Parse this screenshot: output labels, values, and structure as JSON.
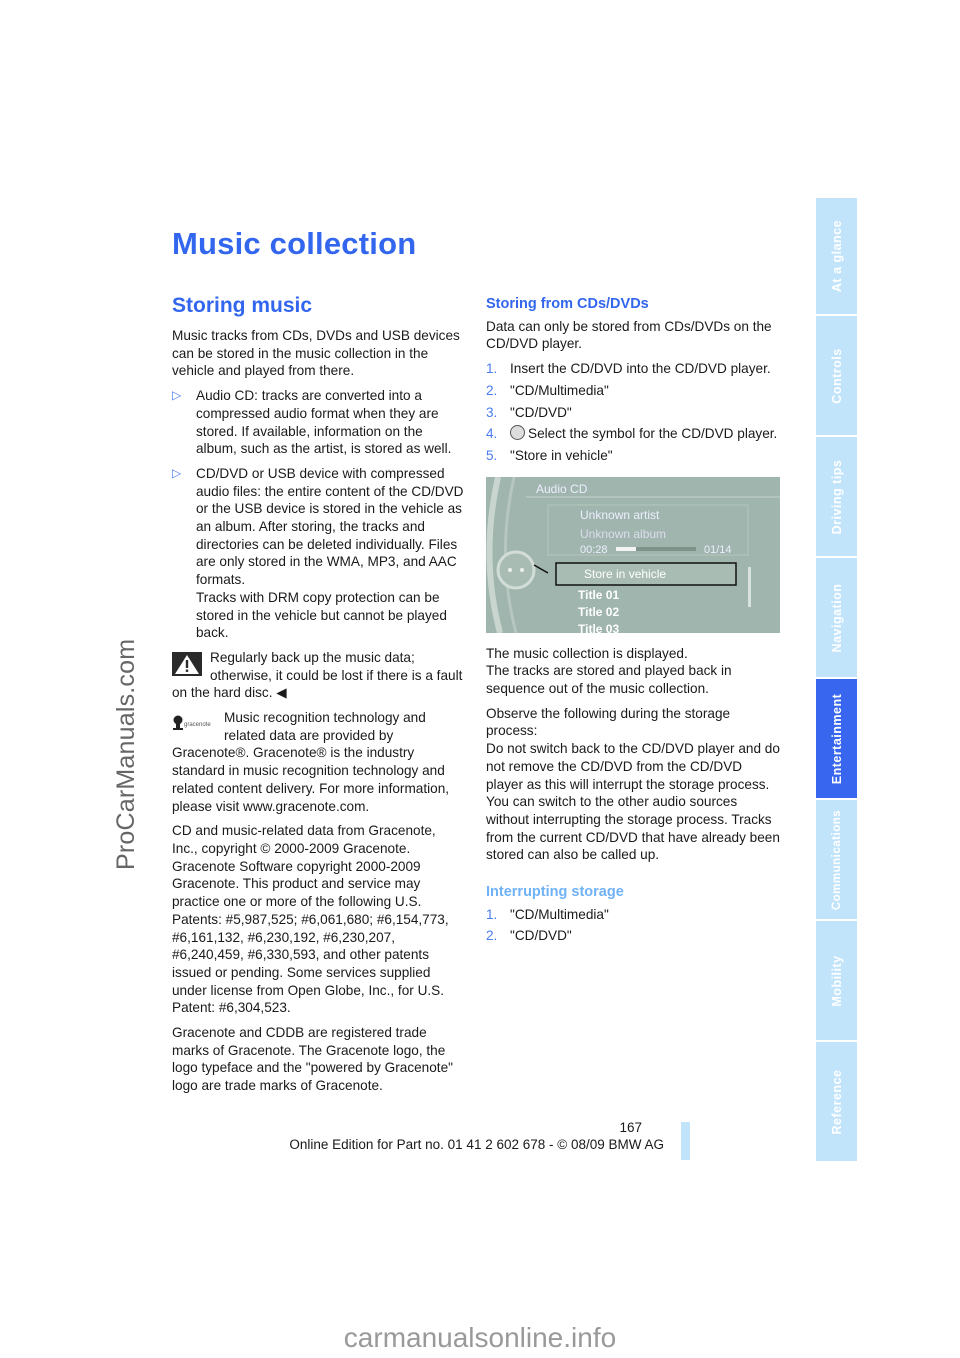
{
  "watermarks": {
    "left": "ProCarManuals.com",
    "bottom": "carmanualsonline.info"
  },
  "page_title": "Music collection",
  "section_title": "Storing music",
  "left_column": {
    "intro": "Music tracks from CDs, DVDs and USB devices can be stored in the music collection in the vehicle and played from there.",
    "bullets": [
      "Audio CD: tracks are converted into a compressed audio format when they are stored. If available, information on the album, such as the artist, is stored as well.",
      "CD/DVD or USB device with compressed audio files: the entire content of the CD/DVD or the USB device is stored in the vehicle as an album. After storing, the tracks and directories can be deleted individually. Files are only stored in the WMA, MP3, and AAC formats."
    ],
    "bullet2_extra": "Tracks with DRM copy protection can be stored in the vehicle but cannot be played back.",
    "warning": "Regularly back up the music data; otherwise, it could be lost if there is a fault on the hard disc.",
    "warning_end": "◀",
    "gracenote_logo_text": "gracenote",
    "gracenote_info": "Music recognition technology and related data are provided by Gracenote®. Gracenote® is the industry standard in music recognition technology and related content delivery. For more information, please visit www.gracenote.com.",
    "copyright": "CD and music-related data from Gracenote, Inc., copyright © 2000-2009 Gracenote. Gracenote Software copyright 2000-2009 Gracenote. This product and service may practice one or more of the following U.S. Patents: #5,987,525; #6,061,680; #6,154,773, #6,161,132, #6,230,192, #6,230,207, #6,240,459, #6,330,593, and other patents issued or pending. Some services supplied under license from Open Globe, Inc., for U.S. Patent: #6,304,523.",
    "trademarks": "Gracenote and CDDB are registered trade marks of Gracenote. The Gracenote logo, the logo typeface and the \"powered by Gracenote\" logo are trade marks of Gracenote."
  },
  "right_column": {
    "storing_title": "Storing from CDs/DVDs",
    "storing_intro": "Data can only be stored from CDs/DVDs on the CD/DVD player.",
    "steps": [
      {
        "num": "1.",
        "text": "Insert the CD/DVD into the CD/DVD player."
      },
      {
        "num": "2.",
        "text": "\"CD/Multimedia\""
      },
      {
        "num": "3.",
        "text": "\"CD/DVD\""
      },
      {
        "num": "4.",
        "text": "Select the symbol for the CD/DVD player."
      },
      {
        "num": "5.",
        "text": "\"Store in vehicle\""
      }
    ],
    "screen": {
      "header": "Audio CD",
      "artist": "Unknown artist",
      "album": "Unknown album",
      "time": "00:28",
      "track_count": "01/14",
      "progress": 0.25,
      "selected_item": "Store in vehicle",
      "titles": [
        "Title 01",
        "Title 02",
        "Title 03"
      ]
    },
    "after_1": "The music collection is displayed.",
    "after_2": "The tracks are stored and played back in sequence out of the music collection.",
    "observe": "Observe the following during the storage process:",
    "observe_detail": "Do not switch back to the CD/DVD player and do not remove the CD/DVD from the CD/DVD player as this will interrupt the storage process. You can switch to the other audio sources without interrupting the storage process. Tracks from the current CD/DVD that have already been stored can also be called up.",
    "interrupt_title": "Interrupting storage",
    "interrupt_steps": [
      {
        "num": "1.",
        "text": "\"CD/Multimedia\""
      },
      {
        "num": "2.",
        "text": "\"CD/DVD\""
      }
    ]
  },
  "side_tabs": [
    {
      "label": "At a glance",
      "active": false
    },
    {
      "label": "Controls",
      "active": false
    },
    {
      "label": "Driving tips",
      "active": false
    },
    {
      "label": "Navigation",
      "active": false
    },
    {
      "label": "Entertainment",
      "active": true
    },
    {
      "label": "Communications",
      "active": false
    },
    {
      "label": "Mobility",
      "active": false
    },
    {
      "label": "Reference",
      "active": false
    }
  ],
  "footer": {
    "page_number": "167",
    "edition": "Online Edition for Part no. 01 41 2 602 678 - © 08/09 BMW AG"
  },
  "colors": {
    "accent": "#3366ee",
    "tab_inactive": "#c2e4fb",
    "tab_active": "#3866ee"
  }
}
